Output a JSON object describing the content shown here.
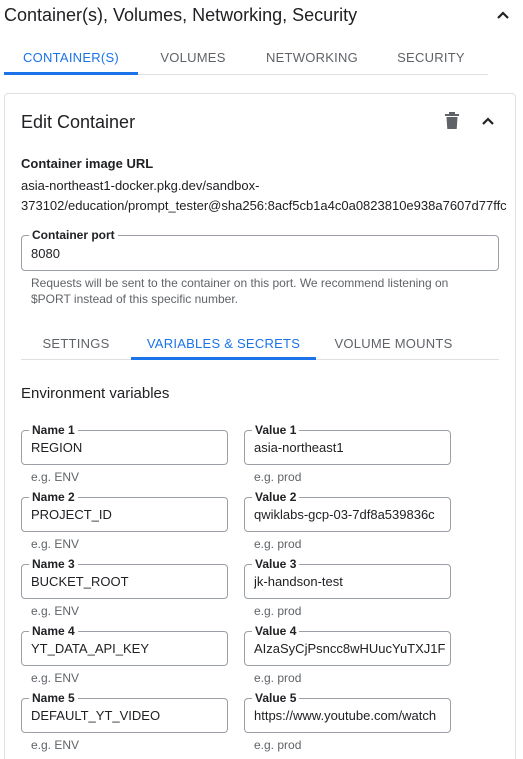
{
  "section": {
    "title": "Container(s), Volumes, Networking, Security"
  },
  "top_tabs": [
    {
      "label": "CONTAINER(S)",
      "active": true
    },
    {
      "label": "VOLUMES",
      "active": false
    },
    {
      "label": "NETWORKING",
      "active": false
    },
    {
      "label": "SECURITY",
      "active": false
    }
  ],
  "edit_container": {
    "title": "Edit Container",
    "image_url_label": "Container image URL",
    "image_url_line1": "asia-northeast1-docker.pkg.dev/sandbox-",
    "image_url_line2": "373102/education/prompt_tester@sha256:8acf5cb1a4c0a0823810e938a7607d77ffc",
    "port_label": "Container port",
    "port_value": "8080",
    "port_hint_line1": "Requests will be sent to the container on this port. We recommend listening on",
    "port_hint_line2": "$PORT instead of this specific number."
  },
  "inner_tabs": [
    {
      "label": "SETTINGS",
      "active": false
    },
    {
      "label": "VARIABLES & SECRETS",
      "active": true
    },
    {
      "label": "VOLUME MOUNTS",
      "active": false
    }
  ],
  "env": {
    "title": "Environment variables",
    "name_hint": "e.g. ENV",
    "value_hint": "e.g. prod",
    "rows": [
      {
        "name_label": "Name 1",
        "name": "REGION",
        "value_label": "Value 1",
        "value": "asia-northeast1"
      },
      {
        "name_label": "Name 2",
        "name": "PROJECT_ID",
        "value_label": "Value 2",
        "value": "qwiklabs-gcp-03-7df8a539836c"
      },
      {
        "name_label": "Name 3",
        "name": "BUCKET_ROOT",
        "value_label": "Value 3",
        "value": "jk-handson-test"
      },
      {
        "name_label": "Name 4",
        "name": "YT_DATA_API_KEY",
        "value_label": "Value 4",
        "value": "AIzaSyCjPsncc8wHUucYuTXJ1F"
      },
      {
        "name_label": "Name 5",
        "name": "DEFAULT_YT_VIDEO",
        "value_label": "Value 5",
        "value": "https://www.youtube.com/watch"
      }
    ]
  },
  "icons": {
    "collapse": "chevron-up-icon",
    "delete": "trash-icon"
  },
  "colors": {
    "accent": "#1a73e8",
    "text": "#202124",
    "muted": "#5f6368",
    "border": "#9aa0a6"
  }
}
